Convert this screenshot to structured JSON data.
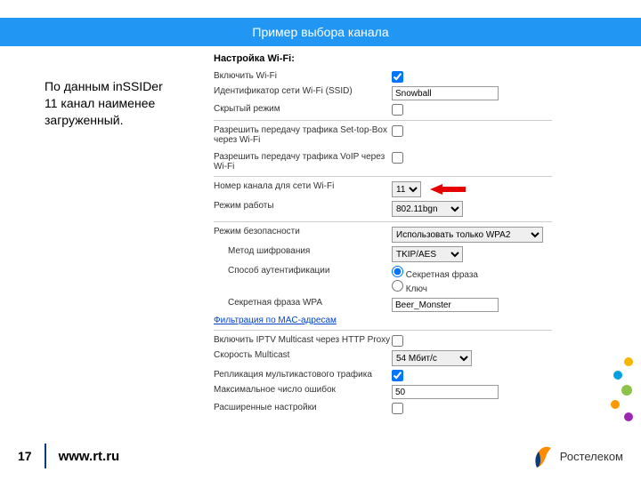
{
  "header": {
    "title": "Пример выбора канала"
  },
  "note": {
    "text": "По данным inSSIDer 11 канал наименее загруженный."
  },
  "wifi": {
    "section_title": "Настройка Wi-Fi:",
    "enable_label": "Включить Wi-Fi",
    "ssid_label": "Идентификатор сети Wi-Fi (SSID)",
    "ssid_value": "Snowball",
    "hidden_label": "Скрытый режим",
    "stb_label": "Разрешить передачу трафика Set-top-Box через Wi-Fi",
    "voip_label": "Разрешить передачу трафика VoIP через Wi-Fi",
    "channel_label": "Номер канала для сети Wi-Fi",
    "channel_value": "11",
    "mode_label": "Режим работы",
    "mode_value": "802.11bgn",
    "security_label": "Режим безопасности",
    "security_value": "Использовать только WPA2",
    "encryption_label": "Метод шифрования",
    "encryption_value": "TKIP/AES",
    "auth_label": "Способ аутентификации",
    "auth_passphrase": "Секретная фраза",
    "auth_key": "Ключ",
    "wpa_phrase_label": "Секретная фраза WPA",
    "wpa_phrase_value": "Beer_Monster",
    "mac_filter_link": "Фильтрация по MAC-адресам",
    "iptv_label": "Включить IPTV Multicast через HTTP Proxy",
    "mcast_speed_label": "Скорость Multicast",
    "mcast_speed_value": "54 Мбит/с",
    "replication_label": "Репликация мультикастового трафика",
    "max_errors_label": "Максимальное число ошибок",
    "max_errors_value": "50",
    "advanced_label": "Расширенные настройки"
  },
  "footer": {
    "page": "17",
    "url": "www.rt.ru",
    "brand": "Ростелеком"
  }
}
